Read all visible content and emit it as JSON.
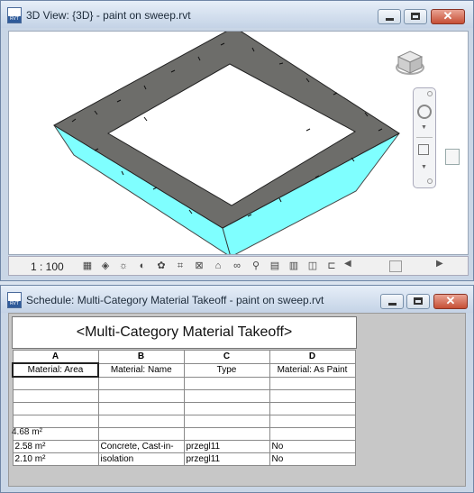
{
  "window_3d": {
    "title": "3D View: {3D} - paint on sweep.rvt",
    "minimize": "minimize",
    "maximize": "maximize",
    "close_label": "✕",
    "scale": "1 : 100",
    "app_icon_text": "RVT"
  },
  "window_schedule": {
    "title": "Schedule: Multi-Category Material Takeoff - paint on sweep.rvt",
    "close_label": "✕",
    "app_icon_text": "RVT",
    "schedule_title": "<Multi-Category Material Takeoff>",
    "column_letters": [
      "A",
      "B",
      "C",
      "D"
    ],
    "column_headers": [
      "Material: Area",
      "Material: Name",
      "Type",
      "Material: As Paint"
    ],
    "rows": [
      [
        "2.58 m²",
        "Concrete, Cast-in-",
        "przegl11",
        "No"
      ],
      [
        "2.10 m²",
        "isolation",
        "przegl11",
        "No"
      ]
    ],
    "total": "4.68 m²"
  },
  "colors": {
    "top_face": "#6d6d6a",
    "side_face": "#7fffff",
    "title_bar": "#c4d3e6",
    "close_button": "#c64f35"
  }
}
